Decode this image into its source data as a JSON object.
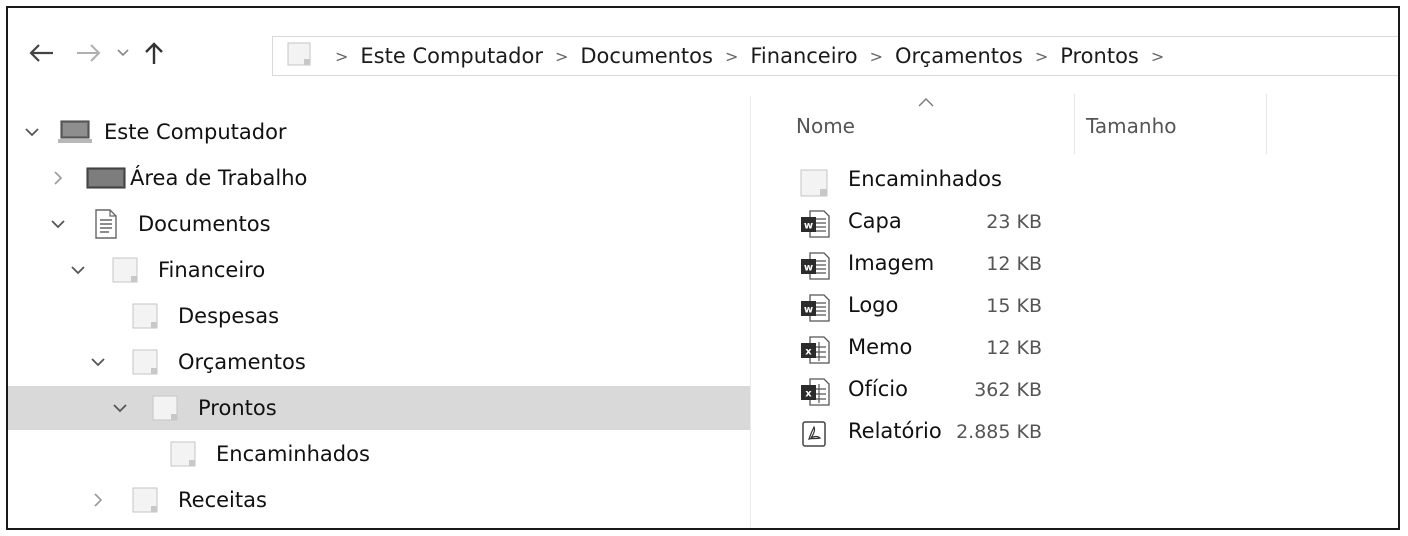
{
  "toolbar": {
    "breadcrumbs": [
      "Este Computador",
      "Documentos",
      "Financeiro",
      "Orçamentos",
      "Prontos"
    ],
    "icons": {
      "back": "arrow-left-icon",
      "forward": "arrow-right-icon",
      "recent": "chevron-down-icon",
      "up": "arrow-up-icon"
    }
  },
  "tree": {
    "items": [
      {
        "label": "Este Computador",
        "icon": "computer-icon"
      },
      {
        "label": "Área de Trabalho",
        "icon": "desktop-icon"
      },
      {
        "label": "Documentos",
        "icon": "documents-icon"
      },
      {
        "label": "Financeiro",
        "icon": "folder-icon"
      },
      {
        "label": "Despesas",
        "icon": "folder-icon"
      },
      {
        "label": "Orçamentos",
        "icon": "folder-icon"
      },
      {
        "label": "Prontos",
        "icon": "folder-icon"
      },
      {
        "label": "Encaminhados",
        "icon": "folder-icon"
      },
      {
        "label": "Receitas",
        "icon": "folder-icon"
      }
    ]
  },
  "columns": {
    "name": "Nome",
    "size": "Tamanho"
  },
  "files": [
    {
      "name": "Encaminhados",
      "size": "",
      "icon": "folder-icon"
    },
    {
      "name": "Capa",
      "size": "23 KB",
      "icon": "word-file-icon"
    },
    {
      "name": "Imagem",
      "size": "12 KB",
      "icon": "word-file-icon"
    },
    {
      "name": "Logo",
      "size": "15 KB",
      "icon": "word-file-icon"
    },
    {
      "name": "Memo",
      "size": "12 KB",
      "icon": "excel-file-icon"
    },
    {
      "name": "Ofício",
      "size": "362 KB",
      "icon": "excel-file-icon"
    },
    {
      "name": "Relatório",
      "size": "2.885 KB",
      "icon": "pdf-file-icon"
    }
  ],
  "colors": {
    "selected_row": "#d9d9d9",
    "word": "#2b579a",
    "excel": "#217346"
  }
}
